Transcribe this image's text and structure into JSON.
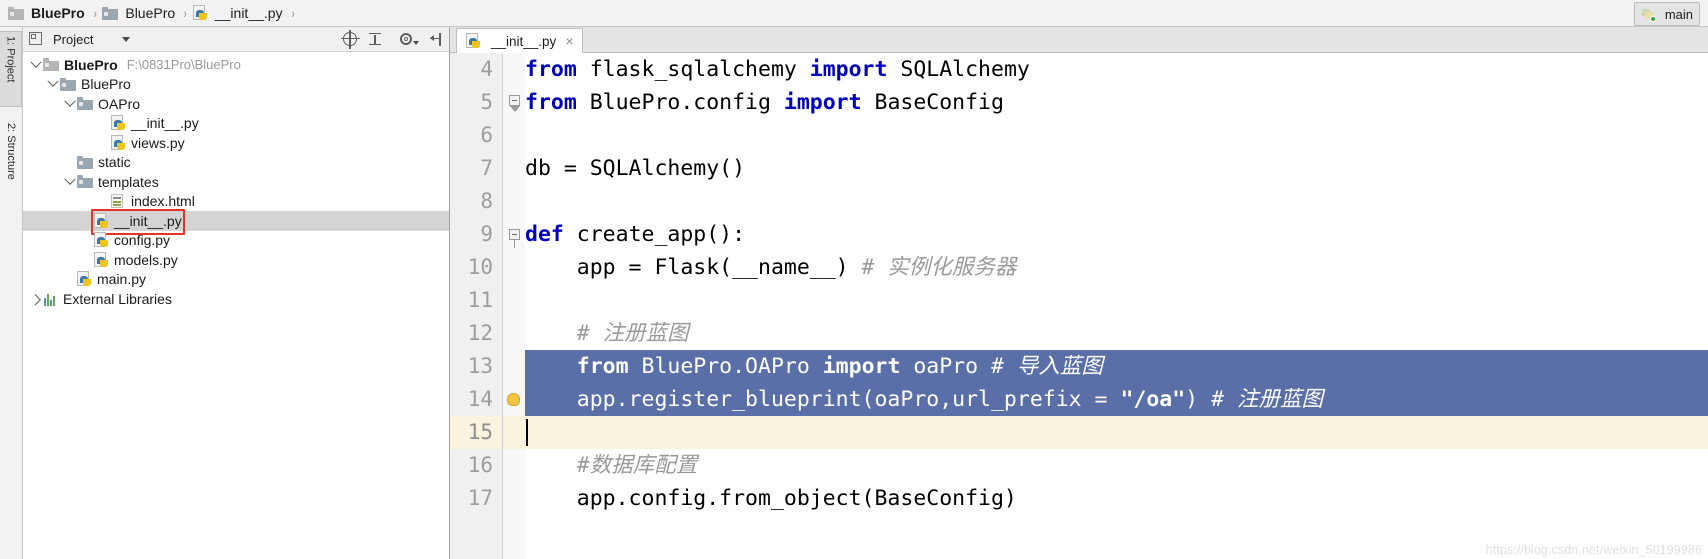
{
  "window": {
    "run_config": {
      "label": "main",
      "icon": "python-run-icon"
    }
  },
  "breadcrumb": {
    "items": [
      {
        "label": "BluePro",
        "icon": "folder-icon",
        "bold": true
      },
      {
        "label": "BluePro",
        "icon": "folder-blue-icon",
        "bold": false
      },
      {
        "label": "__init__.py",
        "icon": "python-file-icon",
        "bold": false
      }
    ],
    "separator": "›"
  },
  "project_panel": {
    "title": "Project",
    "title_icon": "project-view-icon",
    "dropdown_icon": "chevron-down-icon",
    "toolbar_icons": [
      "locate-target-icon",
      "collapse-all-icon",
      "settings-gear-icon",
      "hide-panel-icon"
    ],
    "tree": [
      {
        "depth": 0,
        "arrow": "down",
        "icon": "folder-icon",
        "label": "BluePro",
        "bold": true,
        "path": "F:\\0831Pro\\BluePro",
        "selected": false
      },
      {
        "depth": 1,
        "arrow": "down",
        "icon": "folder-blue-icon",
        "label": "BluePro",
        "bold": false,
        "path": "",
        "selected": false
      },
      {
        "depth": 2,
        "arrow": "down",
        "icon": "folder-blue-icon",
        "label": "OAPro",
        "bold": false,
        "path": "",
        "selected": false
      },
      {
        "depth": 4,
        "arrow": "none",
        "icon": "python-file-icon",
        "label": "__init__.py",
        "bold": false,
        "path": "",
        "selected": false
      },
      {
        "depth": 4,
        "arrow": "none",
        "icon": "python-file-icon",
        "label": "views.py",
        "bold": false,
        "path": "",
        "selected": false
      },
      {
        "depth": 2,
        "arrow": "none",
        "icon": "folder-blue-icon",
        "label": "static",
        "bold": false,
        "path": "",
        "selected": false
      },
      {
        "depth": 2,
        "arrow": "down",
        "icon": "folder-blue-icon",
        "label": "templates",
        "bold": false,
        "path": "",
        "selected": false
      },
      {
        "depth": 4,
        "arrow": "none",
        "icon": "html-file-icon",
        "label": "index.html",
        "bold": false,
        "path": "",
        "selected": false
      },
      {
        "depth": 3,
        "arrow": "none",
        "icon": "python-file-icon",
        "label": "__init__.py",
        "bold": false,
        "path": "",
        "selected": true
      },
      {
        "depth": 3,
        "arrow": "none",
        "icon": "python-file-icon",
        "label": "config.py",
        "bold": false,
        "path": "",
        "selected": false
      },
      {
        "depth": 3,
        "arrow": "none",
        "icon": "python-file-icon",
        "label": "models.py",
        "bold": false,
        "path": "",
        "selected": false
      },
      {
        "depth": 2,
        "arrow": "none",
        "icon": "python-file-icon",
        "label": "main.py",
        "bold": false,
        "path": "",
        "selected": false
      },
      {
        "depth": 0,
        "arrow": "right",
        "icon": "external-libraries-icon",
        "label": "External Libraries",
        "bold": false,
        "path": "",
        "selected": false
      }
    ]
  },
  "tool_strip": {
    "tabs": [
      {
        "label": "1: Project",
        "icon": "project-tool-icon",
        "active": true
      },
      {
        "label": "2: Structure",
        "icon": "structure-tool-icon",
        "active": false
      }
    ]
  },
  "editor": {
    "tabs": [
      {
        "label": "__init__.py",
        "icon": "python-file-icon",
        "close": "×",
        "active": true
      }
    ],
    "first_line_number": 4,
    "current_line": 15,
    "lines": [
      {
        "n": 4,
        "tokens": [
          {
            "t": "from",
            "c": "kw"
          },
          {
            "t": " flask_sqlalchemy ",
            "c": ""
          },
          {
            "t": "import",
            "c": "kw"
          },
          {
            "t": " SQLAlchemy",
            "c": ""
          }
        ],
        "selected": false
      },
      {
        "n": 5,
        "tokens": [
          {
            "t": "from",
            "c": "kw"
          },
          {
            "t": " BluePro.config ",
            "c": ""
          },
          {
            "t": "import",
            "c": "kw"
          },
          {
            "t": " BaseConfig",
            "c": ""
          }
        ],
        "selected": false
      },
      {
        "n": 6,
        "tokens": [],
        "selected": false
      },
      {
        "n": 7,
        "tokens": [
          {
            "t": "db = SQLAlchemy()",
            "c": ""
          }
        ],
        "selected": false
      },
      {
        "n": 8,
        "tokens": [],
        "selected": false
      },
      {
        "n": 9,
        "tokens": [
          {
            "t": "def",
            "c": "kw"
          },
          {
            "t": " create_app():",
            "c": ""
          }
        ],
        "selected": false
      },
      {
        "n": 10,
        "tokens": [
          {
            "t": "    app = Flask(__name__) ",
            "c": ""
          },
          {
            "t": "# 实例化服务器",
            "c": "cm"
          }
        ],
        "selected": false
      },
      {
        "n": 11,
        "tokens": [],
        "selected": false
      },
      {
        "n": 12,
        "tokens": [
          {
            "t": "    ",
            "c": ""
          },
          {
            "t": "# 注册蓝图",
            "c": "cm"
          }
        ],
        "selected": false
      },
      {
        "n": 13,
        "tokens": [
          {
            "t": "    ",
            "c": ""
          },
          {
            "t": "from",
            "c": "kw"
          },
          {
            "t": " BluePro.OAPro ",
            "c": ""
          },
          {
            "t": "import",
            "c": "kw"
          },
          {
            "t": " oaPro ",
            "c": ""
          },
          {
            "t": "# 导入蓝图",
            "c": "cm"
          }
        ],
        "selected": true
      },
      {
        "n": 14,
        "tokens": [
          {
            "t": "    app.register_blueprint(oaPro,url_prefix = ",
            "c": ""
          },
          {
            "t": "\"/oa\"",
            "c": "str"
          },
          {
            "t": ") ",
            "c": ""
          },
          {
            "t": "# 注册蓝图",
            "c": "cm"
          }
        ],
        "selected": true
      },
      {
        "n": 15,
        "tokens": [
          {
            "t": "    ",
            "c": ""
          }
        ],
        "selected": false
      },
      {
        "n": 16,
        "tokens": [
          {
            "t": "    ",
            "c": ""
          },
          {
            "t": "#数据库配置",
            "c": "cm"
          }
        ],
        "selected": false
      },
      {
        "n": 17,
        "tokens": [
          {
            "t": "    app.config.from_object(BaseConfig)",
            "c": ""
          }
        ],
        "selected": false
      }
    ],
    "gutter_markers": [
      {
        "line": 5,
        "type": "fold-end-marker"
      },
      {
        "line": 9,
        "type": "fold-start-marker"
      },
      {
        "line": 14,
        "type": "intention-bulb-icon"
      }
    ],
    "watermark": "https://blog.csdn.net/weixin_50199986"
  },
  "colors": {
    "keyword": "#0000c0",
    "comment": "#9a9a9a",
    "string": "#067d17",
    "selection": "#5a6fa8",
    "current_line": "#faf3dd",
    "tree_selection": "#d4d4d4",
    "red_annotation": "#e8312a"
  }
}
